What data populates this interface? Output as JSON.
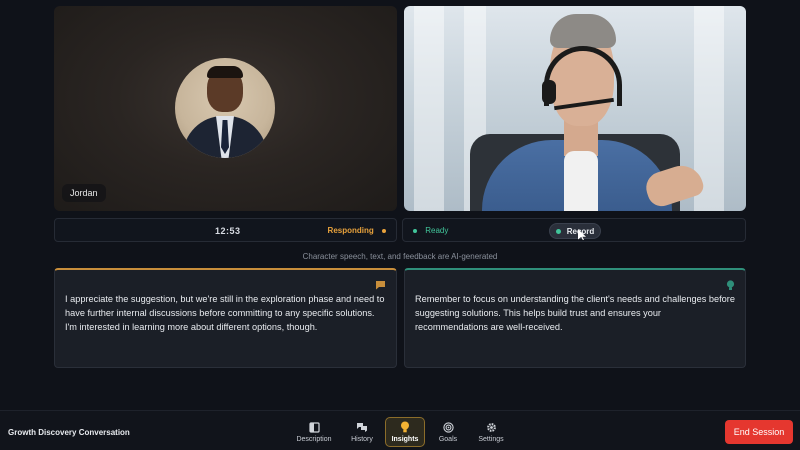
{
  "ai_tile": {
    "name": "Jordan"
  },
  "status": {
    "timer": "12:53",
    "ai_state": "Responding",
    "user_state": "Ready",
    "record_label": "Record"
  },
  "disclaimer": "Character speech, text, and feedback are AI-generated",
  "cards": {
    "ai_message": "I appreciate the suggestion, but we're still in the exploration phase and need to have further internal discussions before committing to any specific solutions. I'm interested in learning more about different options, though.",
    "tip": "Remember to focus on understanding the client's needs and challenges before suggesting solutions. This helps build trust and ensures your recommendations are well-received."
  },
  "bottom": {
    "session_title": "Growth Discovery Conversation",
    "nav": [
      {
        "label": "Description",
        "icon": "description-icon"
      },
      {
        "label": "History",
        "icon": "history-icon"
      },
      {
        "label": "Insights",
        "icon": "lightbulb-icon",
        "active": true
      },
      {
        "label": "Goals",
        "icon": "target-icon"
      },
      {
        "label": "Settings",
        "icon": "gear-icon"
      }
    ],
    "end_label": "End Session"
  },
  "colors": {
    "accent_orange": "#e8a23c",
    "ready_green": "#41c59a",
    "tip_teal": "#2f8f7a",
    "end_red": "#e5372f"
  }
}
